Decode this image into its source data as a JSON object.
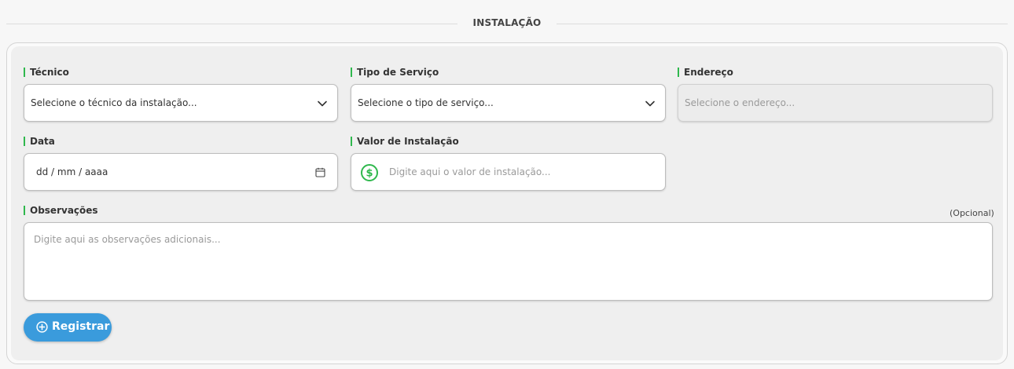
{
  "section": {
    "title": "INSTALAÇÃO"
  },
  "form": {
    "tecnico": {
      "label": "Técnico",
      "placeholder": "Selecione o técnico da instalação...",
      "icon": "chevron-down-icon"
    },
    "tipo_servico": {
      "label": "Tipo de Serviço",
      "placeholder": "Selecione o tipo de serviço...",
      "icon": "chevron-down-icon"
    },
    "endereco": {
      "label": "Endereço",
      "placeholder": "Selecione o endereço..."
    },
    "data": {
      "label": "Data",
      "value": "dd / mm / aaaa",
      "icon": "calendar-icon"
    },
    "valor": {
      "label": "Valor de Instalação",
      "placeholder": "Digite aqui o valor de instalação...",
      "icon": "dollar-circle-icon"
    },
    "observacoes": {
      "label": "Observações",
      "optional": "(Opcional)",
      "placeholder": "Digite aqui as observações adicionais..."
    },
    "submit": {
      "label": "Registrar",
      "icon": "plus-circle-icon"
    }
  },
  "colors": {
    "accent_green": "#2fb84d",
    "button_blue": "#3a9bdc"
  }
}
